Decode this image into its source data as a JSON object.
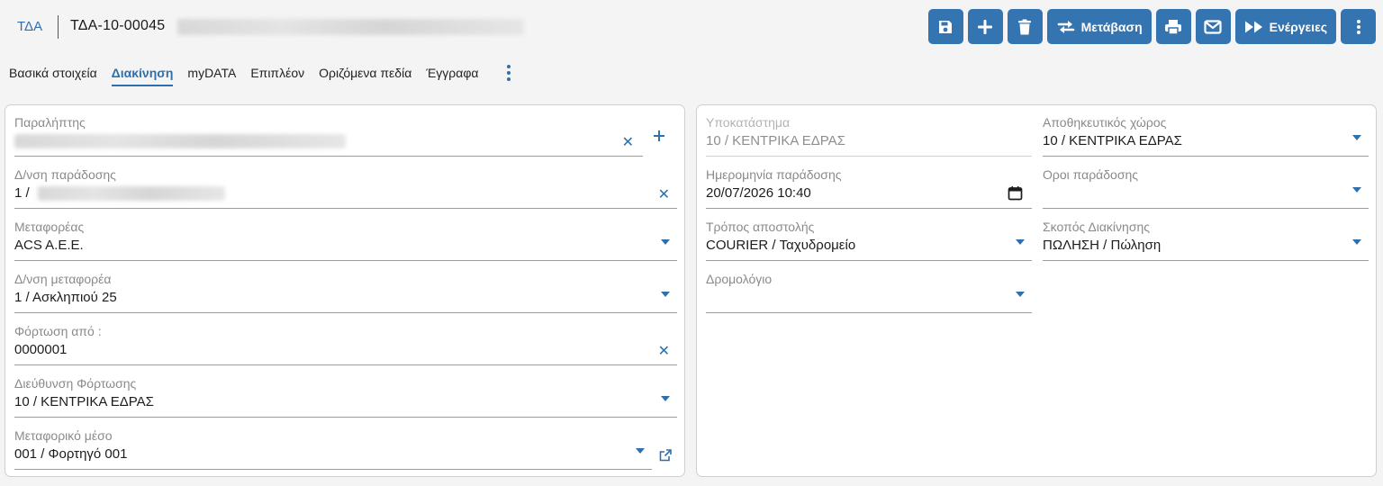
{
  "header": {
    "module": "ΤΔΑ",
    "doc_code": "ΤΔΑ-10-00045"
  },
  "toolbar": {
    "save_icon": "save-icon",
    "add_icon": "plus-icon",
    "delete_icon": "trash-icon",
    "transition_label": "Μετάβαση",
    "print_icon": "printer-icon",
    "mail_icon": "envelope-icon",
    "actions_label": "Ενέργειες",
    "more_icon": "kebab-icon"
  },
  "tabs": [
    {
      "label": "Βασικά στοιχεία"
    },
    {
      "label": "Διακίνηση"
    },
    {
      "label": "myDATA"
    },
    {
      "label": "Επιπλέον"
    },
    {
      "label": "Οριζόμενα πεδία"
    },
    {
      "label": "Έγγραφα"
    }
  ],
  "left": {
    "recipient": {
      "label": "Παραλήπτης",
      "value": ""
    },
    "delivery_address": {
      "label": "Δ/νση παράδοσης",
      "value": "1 /"
    },
    "carrier": {
      "label": "Μεταφορέας",
      "value": "ACS A.E.E."
    },
    "carrier_address": {
      "label": "Δ/νση μεταφορέα",
      "value": "1 / Ασκληπιού 25"
    },
    "loading_from": {
      "label": "Φόρτωση από :",
      "value": "0000001"
    },
    "loading_address": {
      "label": "Διεύθυνση Φόρτωσης",
      "value": "10 / ΚΕΝΤΡΙΚΑ ΕΔΡΑΣ"
    },
    "vehicle": {
      "label": "Μεταφορικό μέσο",
      "value": "001 / Φορτηγό 001"
    }
  },
  "right": {
    "branch": {
      "label": "Υποκατάστημα",
      "value": "10 / ΚΕΝΤΡΙΚΑ ΕΔΡΑΣ"
    },
    "warehouse": {
      "label": "Αποθηκευτικός χώρος",
      "value": "10 / ΚΕΝΤΡΙΚΑ ΕΔΡΑΣ"
    },
    "delivery_date": {
      "label": "Ημερομηνία παράδοσης",
      "value": "20/07/2026 10:40"
    },
    "delivery_terms": {
      "label": "Οροι παράδοσης",
      "value": ""
    },
    "shipping_method": {
      "label": "Τρόπος αποστολής",
      "value": "COURIER / Ταχυδρομείο"
    },
    "movement_purpose": {
      "label": "Σκοπός Διακίνησης",
      "value": "ΠΩΛΗΣΗ / Πώληση"
    },
    "route": {
      "label": "Δρομολόγιο",
      "value": ""
    }
  },
  "colors": {
    "accent": "#3474b0",
    "link": "#2f6fab",
    "background": "#f4f4f5"
  }
}
